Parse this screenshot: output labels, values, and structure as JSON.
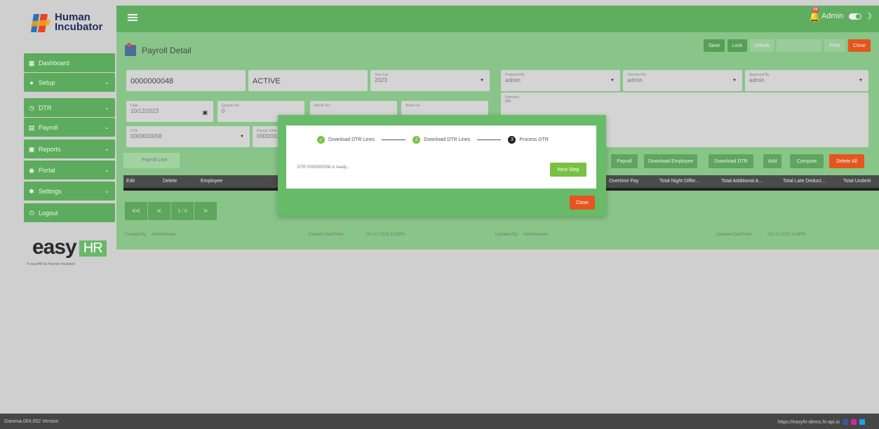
{
  "brand": {
    "name_line1": "Human",
    "name_line2": "Incubator",
    "easy": "easy",
    "hr": "HR",
    "tagline": "© easyHR by Human Incubator"
  },
  "sidebar": {
    "items": [
      {
        "label": "Dashboard",
        "icon": "dashboard-icon"
      },
      {
        "label": "Setup",
        "icon": "setup-icon"
      },
      {
        "label": "DTR",
        "icon": "clock-icon"
      },
      {
        "label": "Payroll",
        "icon": "payroll-icon"
      },
      {
        "label": "Reports",
        "icon": "printer-icon"
      },
      {
        "label": "Portal",
        "icon": "portal-icon"
      },
      {
        "label": "Settings",
        "icon": "gear-icon"
      },
      {
        "label": "Logout",
        "icon": "power-icon"
      }
    ]
  },
  "topbar": {
    "user": "Admin",
    "notif_count": "56"
  },
  "page": {
    "title": "Payroll Detail"
  },
  "toolbar": {
    "save": "Save",
    "lock": "Lock",
    "unlock": "Unlock",
    "print": "Print",
    "close": "Close"
  },
  "form": {
    "payroll_no": "0000000048",
    "status": "ACTIVE",
    "year_label": "Year List",
    "year": "2023",
    "prepared_label": "Prepared By",
    "prepared": "admin",
    "checked_label": "Checked By",
    "checked": "admin",
    "approved_label": "Approved By",
    "approved": "admin",
    "date_label": "Date",
    "date": "10/12/2023",
    "quarter_label": "Quarter No.",
    "quarter": "0",
    "month_label": "Month No.",
    "week_label": "Week No.",
    "remarks_label": "Remarks",
    "remarks": "NA",
    "dtr_label": "DTR",
    "dtr": "0000000058",
    "ptype_label": "Payroll Other",
    "ptype": "0000000"
  },
  "actions": {
    "payroll": "Payroll",
    "download_employee": "Download Employee",
    "download_dtr": "Download DTR",
    "add": "Add",
    "compute": "Compute",
    "delete_all": "Delete All"
  },
  "tab": "Payroll Line",
  "table": {
    "headers": [
      "Edit",
      "Delete",
      "Employee",
      "Overtime Pay",
      "Total Night Differ...",
      "Total Additional A...",
      "Total Late Deduct...",
      "Total Underti"
    ]
  },
  "pager": {
    "first": "<<",
    "prev": "<",
    "page": "1 / 0",
    "next": ">"
  },
  "footer": {
    "created_by_label": "Created By:",
    "created_by": "Administrator",
    "created_dt_label": "Created DateTime:",
    "created_dt": "Oct 12 2023 3:15PM",
    "updated_by_label": "Updated By:",
    "updated_by": "Administrator",
    "updated_dt_label": "Updated DateTime:",
    "updated_dt": "Oct 12 2023 3:48PM"
  },
  "modal": {
    "step1": "Download DTR Lines",
    "step2": "Download DTR Lines",
    "step2_num": "2",
    "step3": "Process DTR",
    "step3_num": "3",
    "message": "DTR 0000000058 is ready...",
    "next": "Next Step",
    "close": "Close"
  },
  "status": {
    "version": "Gamma.004.002 Version",
    "url": "https://easyhr-demo.hi-api.io"
  },
  "colors": {
    "green": "#5fae5f",
    "accent_orange": "#e4561f",
    "next_green": "#79c143"
  }
}
